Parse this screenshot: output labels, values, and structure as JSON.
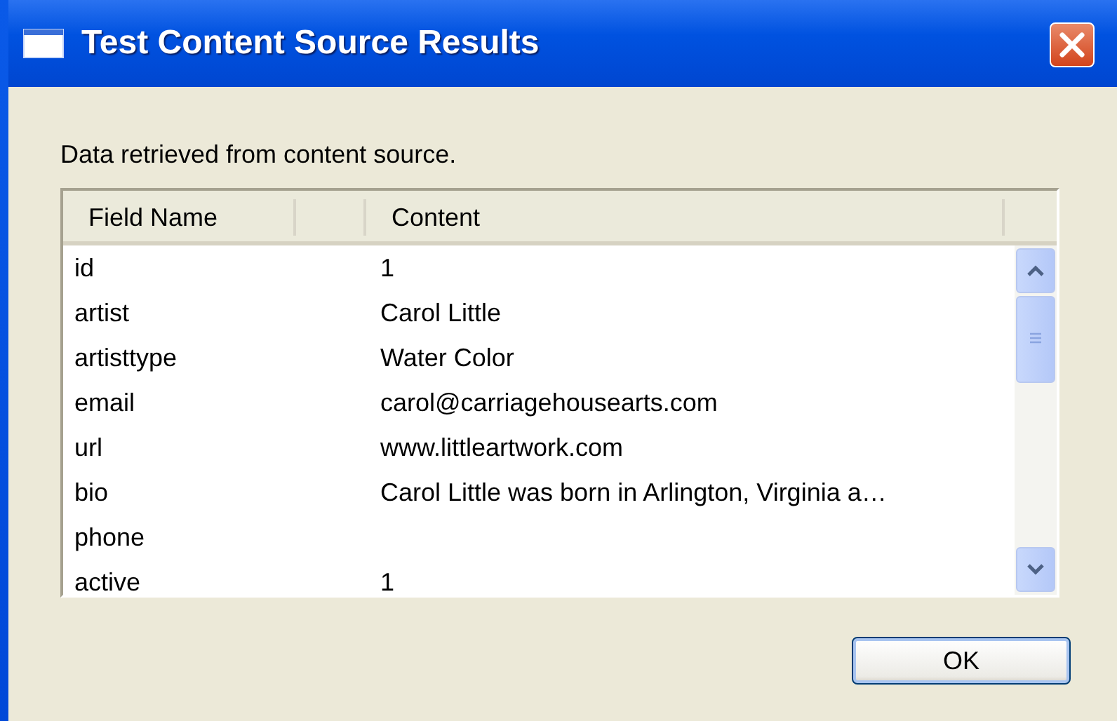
{
  "window": {
    "title": "Test Content Source Results"
  },
  "message": "Data retrieved from content source.",
  "table": {
    "columns": [
      "Field Name",
      "Content"
    ],
    "rows": [
      {
        "field": "id",
        "content": "1"
      },
      {
        "field": "artist",
        "content": "Carol Little"
      },
      {
        "field": "artisttype",
        "content": "Water Color"
      },
      {
        "field": "email",
        "content": "carol@carriagehousearts.com"
      },
      {
        "field": "url",
        "content": "www.littleartwork.com"
      },
      {
        "field": "bio",
        "content": "Carol Little was born in Arlington, Virginia a…"
      },
      {
        "field": "phone"
      },
      {
        "field": "active",
        "content": "1"
      }
    ]
  },
  "buttons": [
    "OK"
  ]
}
